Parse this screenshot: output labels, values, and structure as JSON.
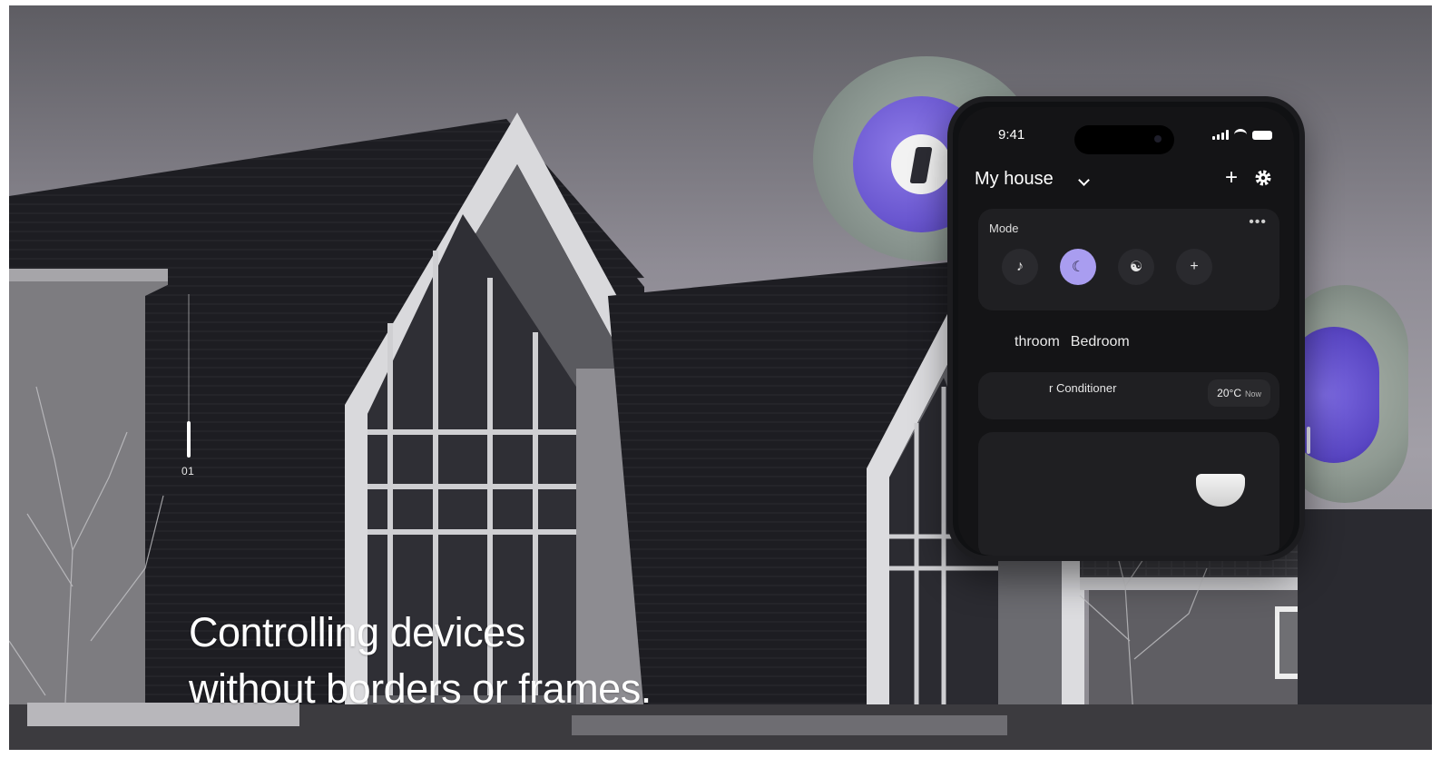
{
  "hero": {
    "headline_line1": "Controlling devices",
    "headline_line2": "without borders or frames.",
    "slide_number": "01",
    "slide_progress": 0.22
  },
  "phone": {
    "time": "9:41",
    "header_title": "My house",
    "mode_label": "Mode",
    "mode_more": "•••",
    "mode_buttons": [
      "music-note-icon",
      "moon-icon",
      "meditation-icon",
      "plus-icon"
    ],
    "active_mode": "moon-icon",
    "rooms": [
      "throom",
      "Bedroom"
    ],
    "device_name": "r Conditioner",
    "device_temp": "20°C",
    "device_temp_note": "Now"
  },
  "colors": {
    "accent_purple": "#6a57d0",
    "active_mode_bg": "#a99df0",
    "phone_bg": "#141416",
    "text_white": "#ffffff"
  }
}
